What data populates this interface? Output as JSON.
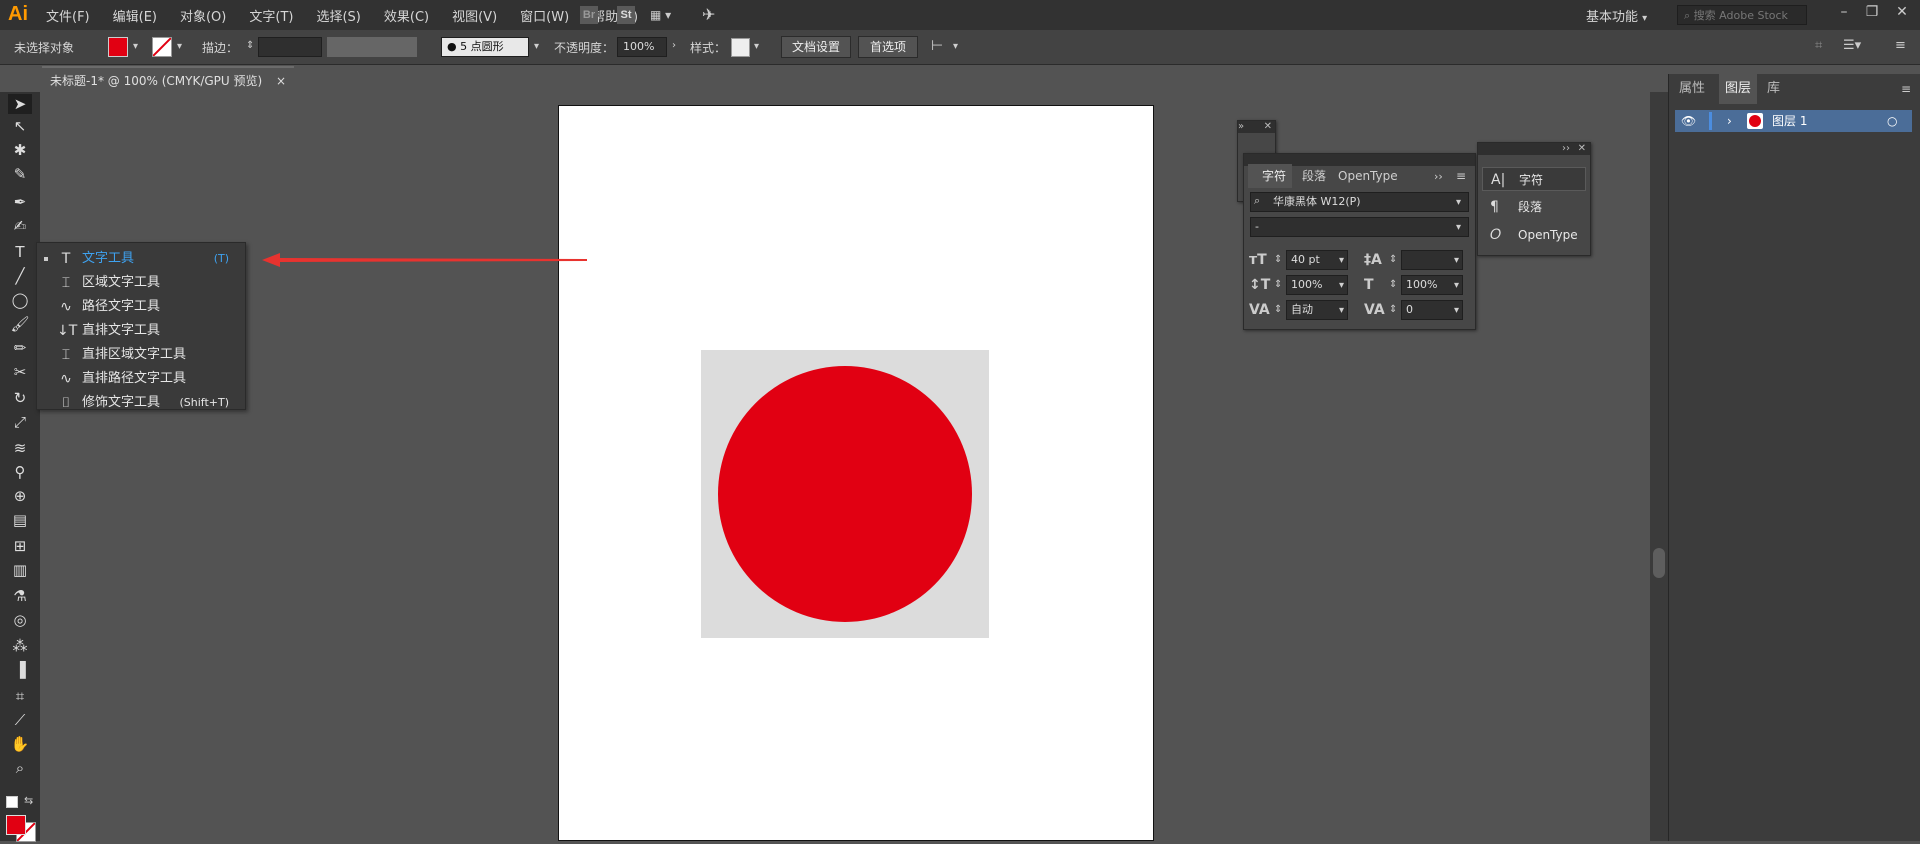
{
  "app": {
    "logo": "Ai",
    "menu": [
      "文件(F)",
      "编辑(E)",
      "对象(O)",
      "文字(T)",
      "选择(S)",
      "效果(C)",
      "视图(V)",
      "窗口(W)",
      "帮助(H)"
    ],
    "bridge": "Br",
    "stock": "St",
    "workspace": "基本功能",
    "search_placeholder": "搜索 Adobe Stock"
  },
  "control": {
    "no_selection": "未选择对象",
    "stroke_label": "描边：",
    "brush": "5 点圆形",
    "opacity_label": "不透明度：",
    "opacity": "100%",
    "style_label": "样式：",
    "doc_setup": "文档设置",
    "prefs": "首选项"
  },
  "tab": {
    "title": "未标题-1* @ 100% (CMYK/GPU 预览)",
    "close": "×"
  },
  "flyout": [
    {
      "icon": "T",
      "label": "文字工具",
      "shortcut": "(T)",
      "active": true
    },
    {
      "icon": "⌶",
      "label": "区域文字工具",
      "shortcut": ""
    },
    {
      "icon": "∿",
      "label": "路径文字工具",
      "shortcut": ""
    },
    {
      "icon": "↓T",
      "label": "直排文字工具",
      "shortcut": ""
    },
    {
      "icon": "⌶",
      "label": "直排区域文字工具",
      "shortcut": ""
    },
    {
      "icon": "∿",
      "label": "直排路径文字工具",
      "shortcut": ""
    },
    {
      "icon": "⌷",
      "label": "修饰文字工具",
      "shortcut": "(Shift+T)"
    }
  ],
  "character_panel": {
    "tabs": [
      "字符",
      "段落",
      "OpenType"
    ],
    "font": "华康黑体 W12(P)",
    "style": "-",
    "size": "40 pt",
    "leading": "",
    "v_scale": "100%",
    "h_scale": "100%",
    "kerning": "自动",
    "tracking": "0"
  },
  "mini_panel": [
    "字符",
    "段落",
    "OpenType"
  ],
  "right_panel": {
    "tabs": [
      "属性",
      "图层",
      "库"
    ],
    "layer": "图层 1"
  },
  "colors": {
    "fill": "#e10012",
    "accent": "#3ea2f0",
    "layer_highlight": "#4b6d98"
  }
}
